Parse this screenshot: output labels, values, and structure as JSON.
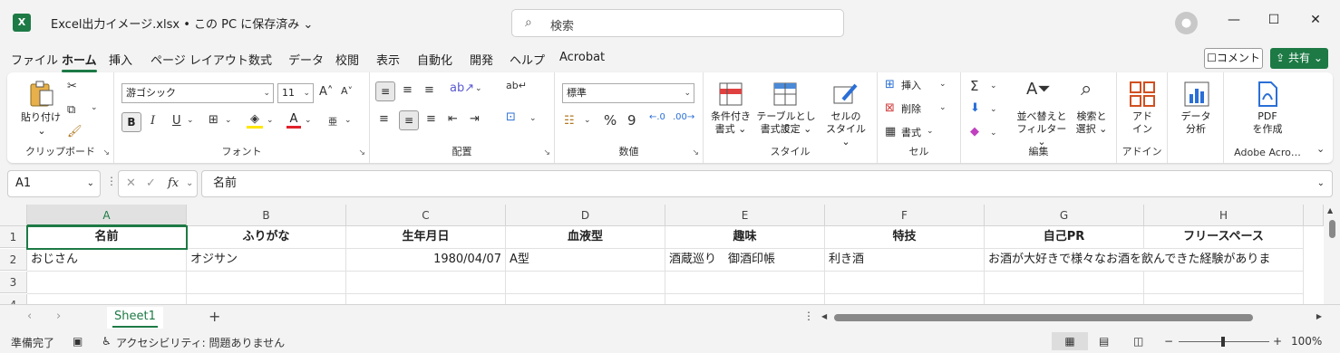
{
  "title_bar": {
    "app_icon": "X",
    "doc_title": "Excel出力イメージ.xlsx • この PC に保存済み ⌄",
    "search_placeholder": "検索",
    "window_controls": [
      "—",
      "☐",
      "✕"
    ]
  },
  "menu": {
    "tabs": [
      "ファイル",
      "ホーム",
      "挿入",
      "ページ レイアウト",
      "数式",
      "データ",
      "校閲",
      "表示",
      "自動化",
      "開発",
      "ヘルプ",
      "Acrobat"
    ],
    "active": "ホーム",
    "comment_label": "コメント",
    "share_label": "共有"
  },
  "ribbon": {
    "clipboard": {
      "label": "クリップボード",
      "paste": "貼り付け"
    },
    "font": {
      "label": "フォント",
      "font_name": "游ゴシック",
      "font_size": "11"
    },
    "alignment": {
      "label": "配置"
    },
    "number": {
      "label": "数値",
      "format": "標準"
    },
    "styles": {
      "label": "スタイル",
      "conditional_1": "条件付き",
      "conditional_2": "書式 ⌄",
      "table_1": "テーブルとして",
      "table_2": "書式設定 ⌄",
      "cell_1": "セルの",
      "cell_2": "スタイル ⌄"
    },
    "cells": {
      "label": "セル",
      "insert": "挿入",
      "delete": "削除",
      "format": "書式"
    },
    "editing": {
      "label": "編集",
      "sort_1": "並べ替えと",
      "sort_2": "フィルター ⌄",
      "find_1": "検索と",
      "find_2": "選択 ⌄"
    },
    "addins": {
      "label": "アドイン",
      "btn_1": "アド",
      "btn_2": "イン"
    },
    "analysis": {
      "btn_1": "データ",
      "btn_2": "分析"
    },
    "adobe": {
      "label": "Adobe Acro…",
      "btn_1": "PDF",
      "btn_2": "を作成"
    }
  },
  "formula_bar": {
    "name_box": "A1",
    "fx": "fx",
    "content": "名前"
  },
  "grid": {
    "columns": [
      "A",
      "B",
      "C",
      "D",
      "E",
      "F",
      "G",
      "H"
    ],
    "rows": [
      "1",
      "2",
      "3",
      "4"
    ],
    "header_row": [
      "名前",
      "ふりがな",
      "生年月日",
      "血液型",
      "趣味",
      "特技",
      "自己PR",
      "フリースペース"
    ],
    "data_row": [
      "おじさん",
      "オジサン",
      "1980/04/07",
      "A型",
      "酒蔵巡り　御酒印帳",
      "利き酒",
      "お酒が大好きで様々なお酒を飲んできた経験がありま",
      ""
    ]
  },
  "sheets": {
    "active": "Sheet1",
    "add": "+"
  },
  "status": {
    "ready": "準備完了",
    "accessibility": "アクセシビリティ: 問題ありません",
    "zoom": "100%"
  },
  "colors": {
    "accent": "#1d7a45"
  }
}
